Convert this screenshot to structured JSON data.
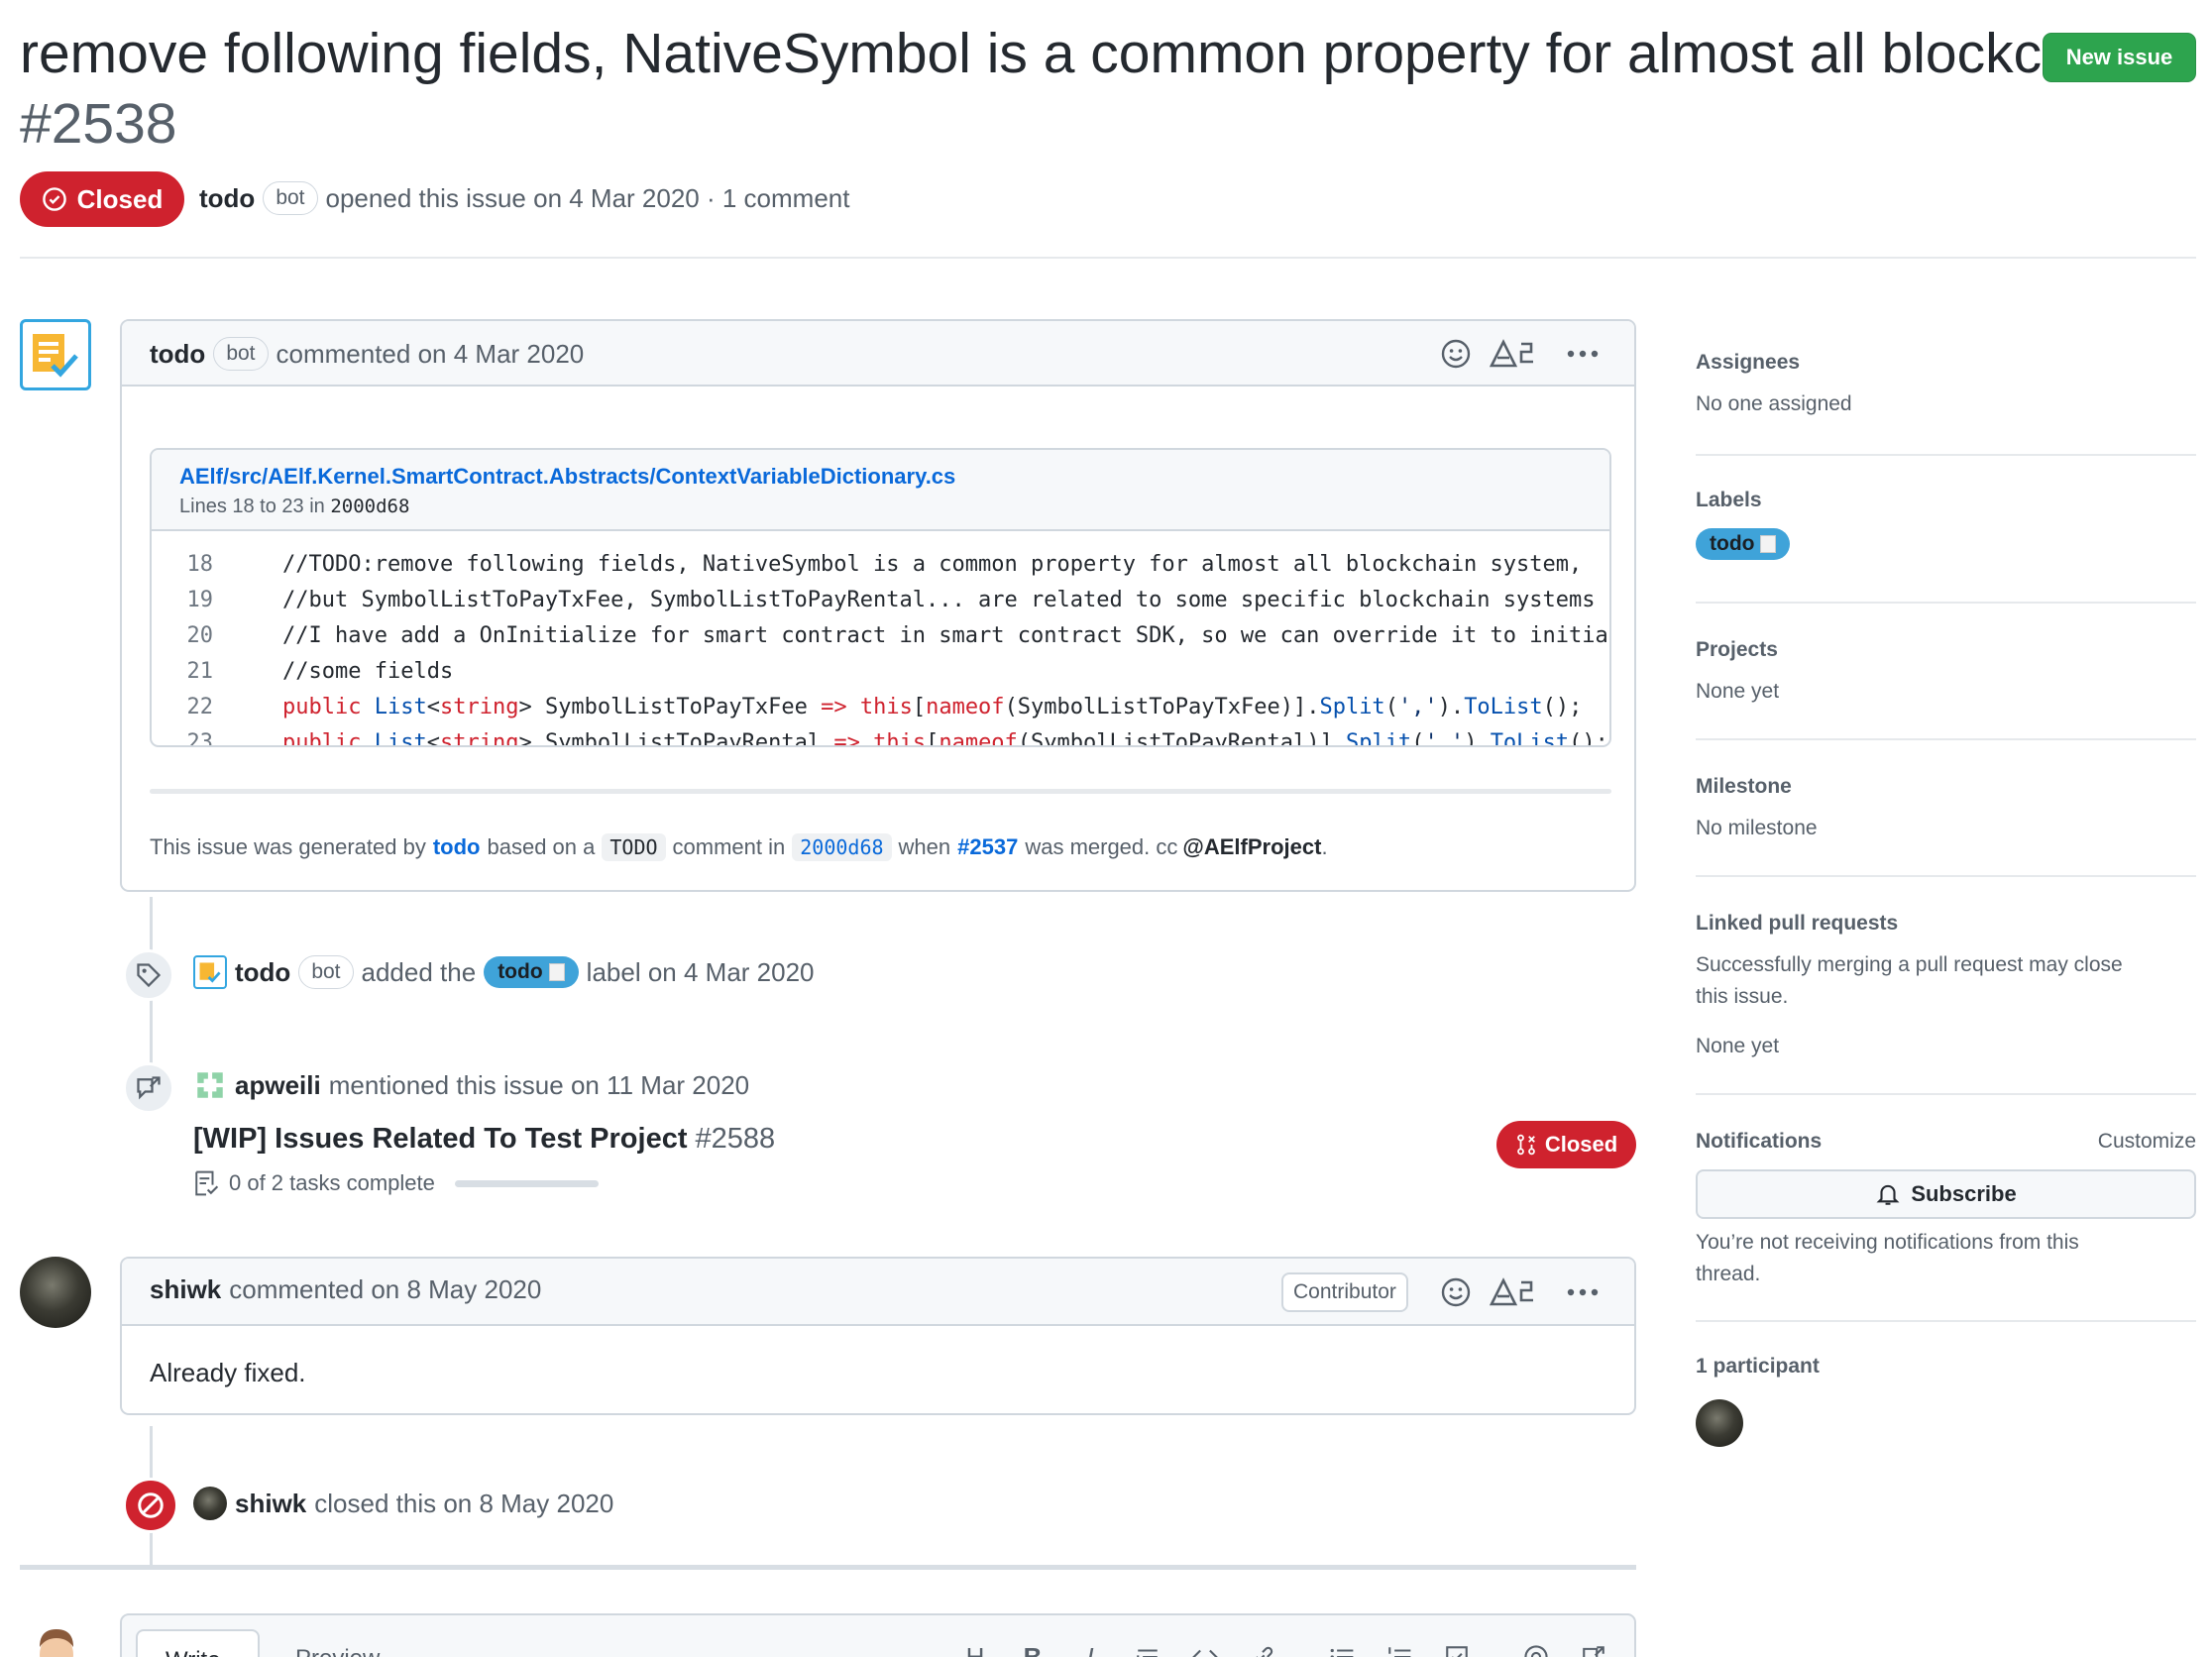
{
  "header": {
    "title": "remove following fields, NativeSymbol is a common property for almost all blockc...",
    "number": "#2538",
    "new_issue": "New issue",
    "state": "Closed",
    "author": "todo",
    "author_tag": "bot",
    "opened_text": "opened this issue on 4 Mar 2020 · 1 comment"
  },
  "first_comment": {
    "author": "todo",
    "author_tag": "bot",
    "action": "commented on 4 Mar 2020",
    "snippet": {
      "path": "AElf/src/AElf.Kernel.SmartContract.Abstracts/ContextVariableDictionary.cs",
      "lines_prefix": "Lines 18 to 23 in",
      "commit": "2000d68",
      "code_lines": [
        {
          "n": "18",
          "text": "//TODO:remove following fields, NativeSymbol is a common property for almost all blockchain system,"
        },
        {
          "n": "19",
          "text": "//but SymbolListToPayTxFee, SymbolListToPayRental... are related to some specific blockchain systems"
        },
        {
          "n": "20",
          "text": "//I have add a OnInitialize for smart contract in smart contract SDK, so we can override it to initiali"
        },
        {
          "n": "21",
          "text": "//some fields"
        },
        {
          "n": "22",
          "text": "public List<string> SymbolListToPayTxFee => this[nameof(SymbolListToPayTxFee)].Split(',').ToList();"
        },
        {
          "n": "23",
          "text": "public List<string> SymbolListToPayRental => this[nameof(SymbolListToPayRental)].Split(',').ToList();"
        }
      ]
    },
    "footer": {
      "p1": "This issue was generated by",
      "bot": "todo",
      "p2": "based on a",
      "todo_chip": "TODO",
      "p3": "comment in",
      "commit": "2000d68",
      "p4": "when",
      "pr": "#2537",
      "p5": "was merged. cc",
      "mention": "@AElfProject",
      "p6": "."
    }
  },
  "label_event": {
    "actor": "todo",
    "actor_tag": "bot",
    "p1": "added the",
    "label": "todo",
    "p2": "label on 4 Mar 2020"
  },
  "mention_event": {
    "actor": "apweili",
    "text": "mentioned this issue on 11 Mar 2020",
    "ref_title": "[WIP] Issues Related To Test Project",
    "ref_number": "#2588",
    "ref_state": "Closed",
    "tasks": "0 of 2 tasks complete",
    "tasks_done": 0,
    "tasks_total": 2
  },
  "second_comment": {
    "author": "shiwk",
    "action": "commented on 8 May 2020",
    "role": "Contributor",
    "body": "Already fixed."
  },
  "closed_event": {
    "actor": "shiwk",
    "text": "closed this on 8 May 2020"
  },
  "editor": {
    "write": "Write",
    "preview": "Preview",
    "tools": [
      "H",
      "B",
      "I"
    ]
  },
  "sidebar": {
    "assignees_h": "Assignees",
    "assignees_v": "No one assigned",
    "labels_h": "Labels",
    "label": "todo",
    "projects_h": "Projects",
    "projects_v": "None yet",
    "milestone_h": "Milestone",
    "milestone_v": "No milestone",
    "linked_h": "Linked pull requests",
    "linked_desc_1": "Successfully merging a pull request may close",
    "linked_desc_2": "this issue.",
    "linked_v": "None yet",
    "notifications_h": "Notifications",
    "customize": "Customize",
    "subscribe": "Subscribe",
    "notif_desc_1": "You’re not receiving notifications from this",
    "notif_desc_2": "thread.",
    "participants_h": "1 participant"
  },
  "colors": {
    "closed": "#cf222e",
    "green": "#2da44e",
    "link": "#0969da",
    "label_blue": "#3fa3d9"
  }
}
